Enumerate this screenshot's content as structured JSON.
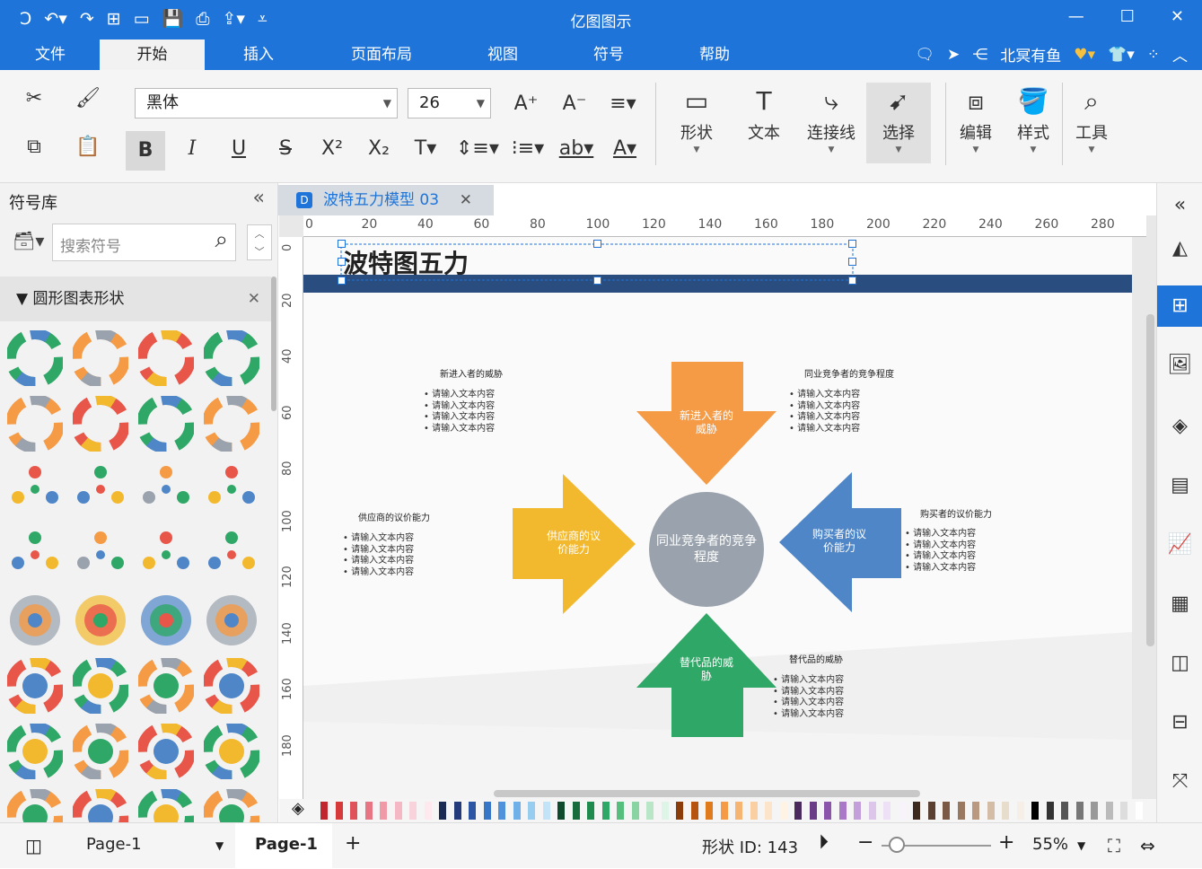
{
  "app": {
    "title": "亿图图示",
    "menus": [
      "文件",
      "开始",
      "插入",
      "页面布局",
      "视图",
      "符号",
      "帮助"
    ],
    "active_menu": "开始",
    "user_name": "北冥有鱼"
  },
  "ribbon": {
    "font_name": "黑体",
    "font_size": "26",
    "buttons": {
      "shape": "形状",
      "text": "文本",
      "connector": "连接线",
      "select": "选择",
      "edit": "编辑",
      "style": "样式",
      "tools": "工具"
    }
  },
  "left_panel": {
    "title": "符号库",
    "search_placeholder": "搜索符号",
    "category": "圆形图表形状"
  },
  "document": {
    "tab_title": "波特五力模型 03",
    "ruler_h": [
      "0",
      "20",
      "40",
      "60",
      "80",
      "100",
      "120",
      "140",
      "160",
      "180",
      "200",
      "220",
      "240",
      "260",
      "280"
    ],
    "ruler_v": [
      "0",
      "20",
      "40",
      "60",
      "80",
      "100",
      "120",
      "140",
      "160",
      "180"
    ]
  },
  "diagram": {
    "title": "波特图五力",
    "center": "同业竞争者的竞争程度",
    "arrows": {
      "top": "新进入者的威胁",
      "left": "供应商的议价能力",
      "right": "购买者的议价能力",
      "bottom": "替代品的威胁"
    },
    "labels": {
      "top_left": "新进入者的威胁",
      "top_right": "同业竞争者的竞争程度",
      "left": "供应商的议价能力",
      "right": "购买者的议价能力",
      "bottom": "替代品的威胁"
    },
    "bullet": "请输入文本内容",
    "colors": {
      "orange": "#f59a45",
      "yellow": "#f3b92e",
      "blue": "#4e86c8",
      "green": "#2fa766",
      "gray": "#9aa3ad",
      "header": "#2a4d80"
    }
  },
  "status": {
    "page_select": "Page-1",
    "page_tab": "Page-1",
    "shape_id": "形状 ID: 143",
    "zoom": "55%"
  }
}
